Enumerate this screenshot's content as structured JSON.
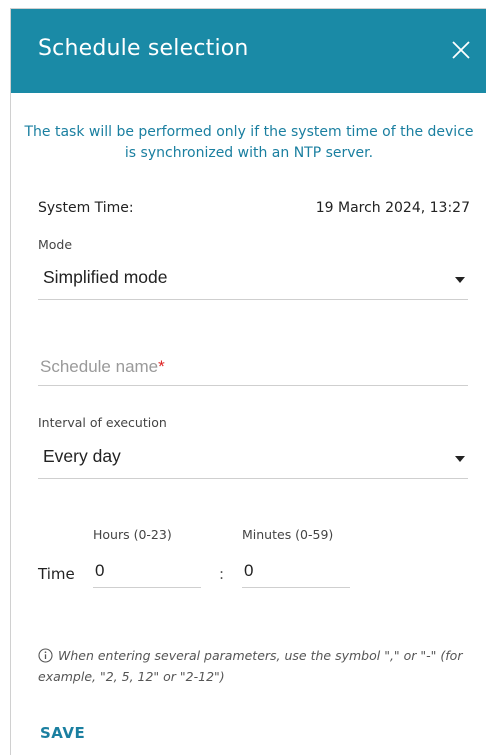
{
  "dialog": {
    "title": "Schedule selection",
    "close_icon": "close-icon"
  },
  "notice": "The task will be performed only if the system time of the device is synchronized with an NTP server.",
  "system_time": {
    "label": "System Time:",
    "value": "19 March 2024, 13:27"
  },
  "mode": {
    "label": "Mode",
    "value": "Simplified mode"
  },
  "schedule_name": {
    "placeholder": "Schedule name",
    "required_mark": "*",
    "value": ""
  },
  "interval": {
    "label": "Interval of execution",
    "value": "Every day"
  },
  "time": {
    "label": "Time",
    "separator": ":",
    "hours_label": "Hours (0-23)",
    "hours_value": "0",
    "minutes_label": "Minutes (0-59)",
    "minutes_value": "0"
  },
  "hint": {
    "icon": "info-icon",
    "text": "When entering several parameters, use the symbol \",\" or \"-\" (for example, \"2, 5, 12\" or \"2-12\")"
  },
  "actions": {
    "save_label": "SAVE"
  },
  "colors": {
    "header": "#1a8aa6",
    "accent_text": "#1a7fa0",
    "required": "#dd2222"
  }
}
